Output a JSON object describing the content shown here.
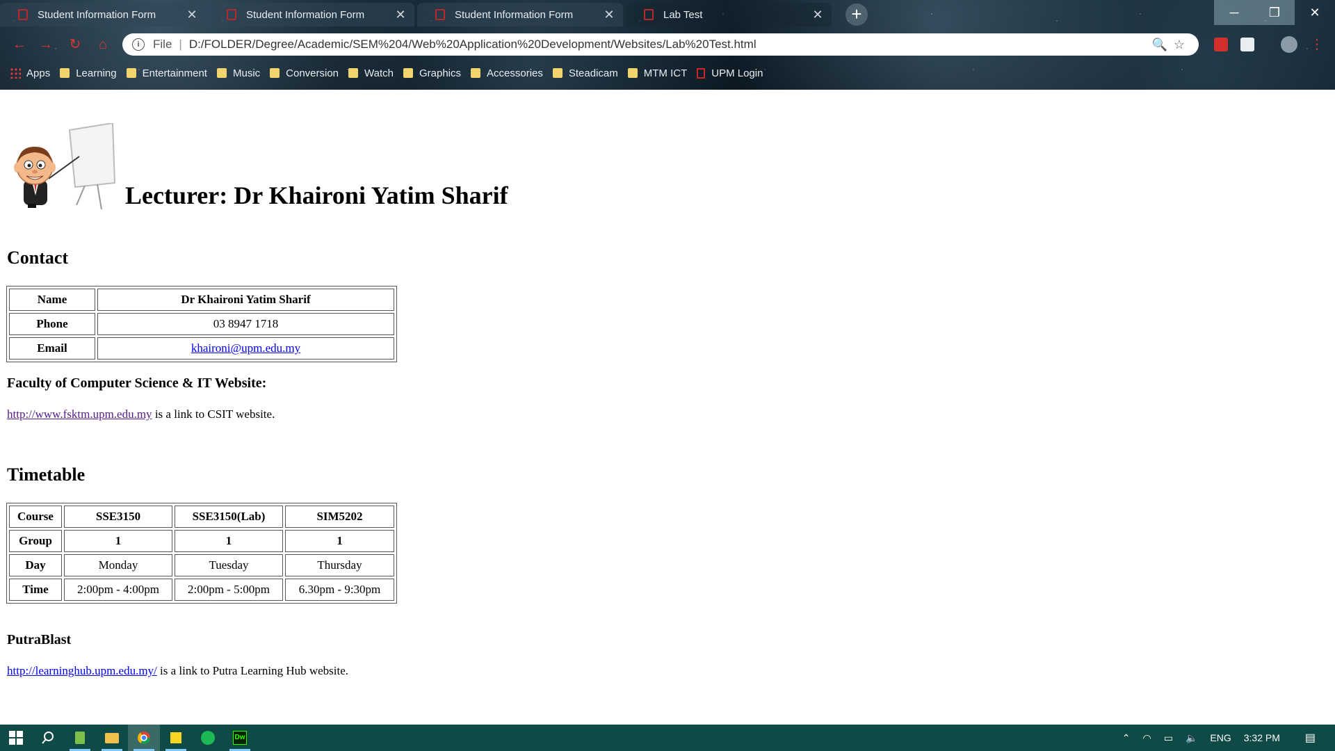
{
  "browser": {
    "tabs": [
      {
        "title": "Student Information Form"
      },
      {
        "title": "Student Information Form"
      },
      {
        "title": "Student Information Form"
      },
      {
        "title": "Lab Test"
      }
    ],
    "address": {
      "scheme_label": "File",
      "url": "D:/FOLDER/Degree/Academic/SEM%204/Web%20Application%20Development/Websites/Lab%20Test.html"
    },
    "bookmarks": [
      {
        "label": "Apps",
        "icon": "apps-grid-icon"
      },
      {
        "label": "Learning",
        "icon": "folder-icon"
      },
      {
        "label": "Entertainment",
        "icon": "folder-icon"
      },
      {
        "label": "Music",
        "icon": "folder-icon"
      },
      {
        "label": "Conversion",
        "icon": "folder-icon"
      },
      {
        "label": "Watch",
        "icon": "folder-icon"
      },
      {
        "label": "Graphics",
        "icon": "folder-icon"
      },
      {
        "label": "Accessories",
        "icon": "folder-icon"
      },
      {
        "label": "Steadicam",
        "icon": "folder-icon"
      },
      {
        "label": "MTM ICT",
        "icon": "folder-icon"
      },
      {
        "label": "UPM Login",
        "icon": "pdf-icon"
      }
    ]
  },
  "page": {
    "lecturer_heading": "Lecturer: Dr Khaironi Yatim Sharif",
    "contact_heading": "Contact",
    "contact": {
      "name_label": "Name",
      "name_value": "Dr Khaironi Yatim Sharif",
      "phone_label": "Phone",
      "phone_value": "03 8947 1718",
      "email_label": "Email",
      "email_value": "khaironi@upm.edu.my"
    },
    "faculty_heading": "Faculty of Computer Science & IT Website:",
    "faculty_link": "http://www.fsktm.upm.edu.my",
    "faculty_text": " is a link to CSIT website.",
    "timetable_heading": "Timetable",
    "timetable": {
      "course_label": "Course",
      "courses": [
        "SSE3150",
        "SSE3150(Lab)",
        "SIM5202"
      ],
      "group_label": "Group",
      "groups": [
        "1",
        "1",
        "1"
      ],
      "day_label": "Day",
      "days": [
        "Monday",
        "Tuesday",
        "Thursday"
      ],
      "time_label": "Time",
      "times": [
        "2:00pm - 4:00pm",
        "2:00pm - 5:00pm",
        "6.30pm - 9:30pm"
      ]
    },
    "putra_heading": "PutraBlast",
    "putra_link": "http://learninghub.upm.edu.my/",
    "putra_text": " is a link to Putra Learning Hub website."
  },
  "taskbar": {
    "language": "ENG",
    "time": "3:32 PM"
  },
  "colors": {
    "link": "#0000ee",
    "visited_link": "#551a8b",
    "taskbar": "#0f4a46"
  }
}
